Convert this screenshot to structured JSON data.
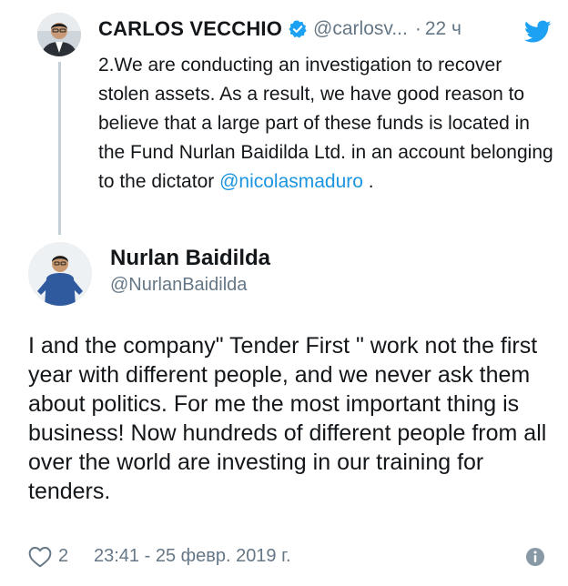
{
  "parent_tweet": {
    "author_name": "CARLOS VECCHIO",
    "handle": "@carlosv...",
    "separator": "·",
    "time_ago": "22 ч",
    "text_before_mention": "2.We are conducting an investigation to recover stolen assets. As a result, we have good reason to believe that a large part of these funds is located in the Fund Nurlan Baidilda Ltd. in an account belonging to the dictator ",
    "mention": "@nicolasmaduro",
    "text_after_mention": " .",
    "verified": true
  },
  "reply_tweet": {
    "author_name": "Nurlan Baidilda",
    "handle": "@NurlanBaidilda",
    "text": "I and the company\" Tender First \" work not the first year with different people, and we never ask them about politics. For me the most important thing is business! Now hundreds of different people from all over the world are investing in our training for tenders.",
    "like_count": "2",
    "timestamp": "23:41 - 25 февр. 2019 г."
  },
  "icons": {
    "verified": "verified-badge-icon",
    "brand": "twitter-bird-icon",
    "like": "heart-icon",
    "info": "info-icon"
  },
  "colors": {
    "brand_blue": "#1da1f2",
    "link_blue": "#1b95e0",
    "muted_gray": "#657786",
    "text_dark": "#14171a"
  }
}
